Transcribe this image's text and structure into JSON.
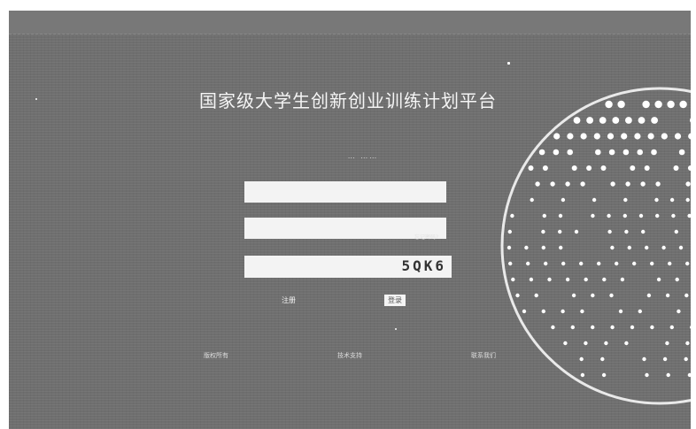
{
  "app": {
    "title": "国家级大学生创新创业训练计划平台",
    "subtitle": "… ……"
  },
  "login": {
    "username_placeholder": "",
    "password_placeholder": "",
    "forgot_label": "忘记密码?",
    "captcha_placeholder": "",
    "captcha_code": "5QK6",
    "register_label": "注册",
    "login_label": "登录"
  },
  "footer": {
    "links": [
      "版权所有",
      "技术支持",
      "联系我们"
    ]
  },
  "colors": {
    "background": "#6f6f6f",
    "field": "#f3f3f3",
    "text": "#f5f5f5"
  }
}
